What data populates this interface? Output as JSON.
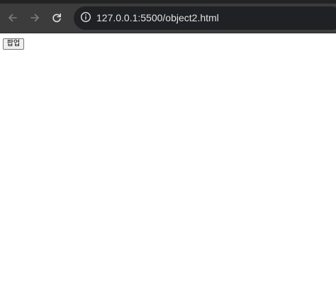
{
  "browser": {
    "address_bar": {
      "url": "127.0.0.1:5500/object2.html",
      "site_info_icon": "info-circle-icon"
    },
    "nav": {
      "back_icon": "arrow-left-icon",
      "forward_icon": "arrow-right-icon",
      "reload_icon": "reload-icon"
    },
    "colors": {
      "toolbar": "#3c3c3c",
      "omnibox": "#202124",
      "url_text": "#e3e3e3"
    }
  },
  "page": {
    "popup_button_label": "팝업"
  }
}
